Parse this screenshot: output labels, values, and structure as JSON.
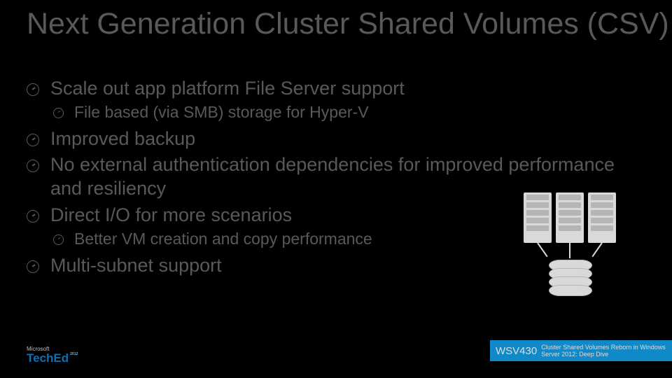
{
  "title": "Next Generation Cluster Shared Volumes (CSV)",
  "bullets": {
    "b1": "Scale out app platform File Server support",
    "b1s1": "File based (via SMB) storage for Hyper-V",
    "b2": "Improved backup",
    "b3": "No external authentication dependencies for improved performance and resiliency",
    "b4": "Direct I/O for more scenarios",
    "b4s1": "Better VM creation and copy performance",
    "b5": "Multi-subnet support"
  },
  "logo": {
    "vendor": "Microsoft",
    "brand": "TechEd",
    "year": "2012"
  },
  "ribbon": {
    "code": "WSV430",
    "text": "Cluster Shared Volumes Reborn in Windows Server 2012: Deep Dive"
  }
}
